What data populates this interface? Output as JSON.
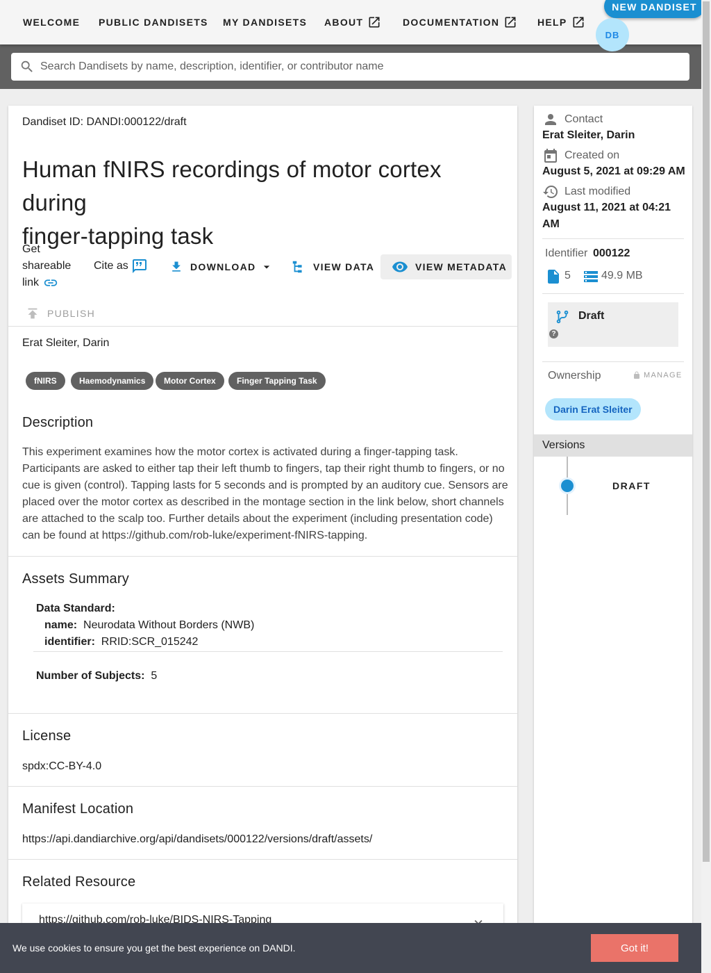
{
  "nav": {
    "items": [
      {
        "label": "WELCOME",
        "external": false
      },
      {
        "label": "PUBLIC DANDISETS",
        "external": false
      },
      {
        "label": "MY DANDISETS",
        "external": false
      },
      {
        "label": "ABOUT",
        "external": true
      },
      {
        "label": "DOCUMENTATION",
        "external": true
      },
      {
        "label": "HELP",
        "external": true
      }
    ],
    "new_dandiset_label": "NEW DANDISET",
    "avatar_initials": "DB"
  },
  "search": {
    "placeholder": "Search Dandisets by name, description, identifier, or contributor name"
  },
  "dandiset": {
    "id_line": "Dandiset ID: DANDI:000122/draft",
    "title_line1": "Human fNIRS recordings of motor cortex during",
    "title_line2": "finger-tapping task",
    "contributors_line": "Erat Sleiter, Darin"
  },
  "toolbar": {
    "share_line1": "Get",
    "share_line2": "shareable",
    "share_line3": "link",
    "cite_label": "Cite as",
    "download_label": "DOWNLOAD",
    "view_data_label": "VIEW DATA",
    "view_metadata_label": "VIEW METADATA",
    "publish_label": "PUBLISH"
  },
  "keywords": [
    "fNIRS",
    "Haemodynamics",
    "Motor Cortex",
    "Finger Tapping Task"
  ],
  "description": {
    "heading": "Description",
    "text": "This experiment examines how the motor cortex is activated during a finger-tapping task. Participants are asked to either tap their left thumb to fingers, tap their right thumb to fingers, or no cue is given (control). Tapping lasts for 5 seconds and is prompted by an auditory cue. Sensors are placed over the motor cortex as described in the montage section in the link below, short channels are attached to the scalp too. Further details about the experiment (including presentation code) can be found at https://github.com/rob-luke/experiment-fNIRS-tapping."
  },
  "assets_summary": {
    "heading": "Assets Summary",
    "data_standard_label": "Data Standard:",
    "name_key": "name:",
    "name_value": "Neurodata Without Borders (NWB)",
    "identifier_key": "identifier:",
    "identifier_value": "RRID:SCR_015242",
    "subjects_key": "Number of Subjects:",
    "subjects_value": "5"
  },
  "license": {
    "heading": "License",
    "value": "spdx:CC-BY-4.0"
  },
  "manifest": {
    "heading": "Manifest Location",
    "url": "https://api.dandiarchive.org/api/dandisets/000122/versions/draft/assets/"
  },
  "related": {
    "heading": "Related Resource",
    "url": "https://github.com/rob-luke/BIDS-NIRS-Tapping"
  },
  "sidebar": {
    "contact_label": "Contact",
    "contact_value": "Erat Sleiter, Darin",
    "created_label": "Created on",
    "created_value": "August 5, 2021 at 09:29 AM",
    "modified_label": "Last modified",
    "modified_line1": "August 11, 2021 at 04:21",
    "modified_line2": "AM",
    "identifier_label": "Identifier",
    "identifier_value": "000122",
    "file_count": "5",
    "size": "49.9 MB",
    "version_status": "Draft",
    "help_glyph": "?",
    "ownership_label": "Ownership",
    "manage_label": "MANAGE",
    "owner_name": "Darin Erat Sleiter",
    "versions_label": "Versions",
    "version_item": "DRAFT"
  },
  "cookie": {
    "text": "We use cookies to ensure you get the best experience on DANDI.",
    "button_label": "Got it!"
  },
  "colors": {
    "accent": "#1b8fd1",
    "search_band": "#616161",
    "keyword_chip": "#616161",
    "owner_chip": "#b3e5fc",
    "cookie_bg": "#424651",
    "cookie_button": "#ea7369"
  }
}
